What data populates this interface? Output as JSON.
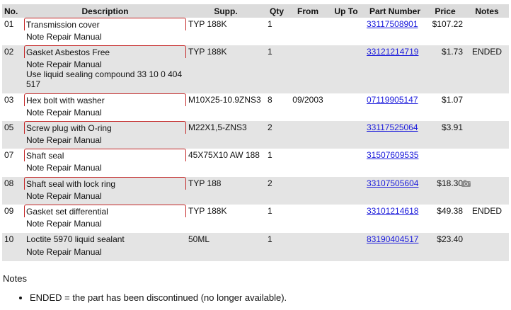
{
  "table": {
    "headers": {
      "no": "No.",
      "description": "Description",
      "supp": "Supp.",
      "qty": "Qty",
      "from": "From",
      "upto": "Up To",
      "part_number": "Part Number",
      "price": "Price",
      "notes": "Notes"
    },
    "rows": [
      {
        "no": "01",
        "desc": "Transmission cover",
        "note": "Note Repair Manual",
        "note2": "",
        "supp": "TYP 188K",
        "qty": "1",
        "from": "",
        "upto": "",
        "part_number": "33117508901",
        "price": "$107.22",
        "notes": ""
      },
      {
        "no": "02",
        "desc": "Gasket Asbestos Free",
        "note": "Note Repair Manual",
        "note2": "Use liquid sealing compound 33 10 0 404 517",
        "supp": "TYP 188K",
        "qty": "1",
        "from": "",
        "upto": "",
        "part_number": "33121214719",
        "price": "$1.73",
        "notes": "ENDED"
      },
      {
        "no": "03",
        "desc": "Hex bolt with washer",
        "note": "Note Repair Manual",
        "note2": "",
        "supp": "M10X25-10.9ZNS3",
        "qty": "8",
        "from": "09/2003",
        "upto": "",
        "part_number": "07119905147",
        "price": "$1.07",
        "notes": ""
      },
      {
        "no": "05",
        "desc": "Screw plug with O-ring",
        "note": "Note Repair Manual",
        "note2": "",
        "supp": "M22X1,5-ZNS3",
        "qty": "2",
        "from": "",
        "upto": "",
        "part_number": "33117525064",
        "price": "$3.91",
        "notes": ""
      },
      {
        "no": "07",
        "desc": "Shaft seal",
        "note": "Note Repair Manual",
        "note2": "",
        "supp": "45X75X10 AW 188",
        "qty": "1",
        "from": "",
        "upto": "",
        "part_number": "31507609535",
        "price": "",
        "notes": ""
      },
      {
        "no": "08",
        "desc": "Shaft seal with lock ring",
        "note": "Note Repair Manual",
        "note2": "",
        "supp": "TYP 188",
        "qty": "2",
        "from": "",
        "upto": "",
        "part_number": "33107505604",
        "price": "$18.30",
        "notes": "",
        "camera_icon": "camera-icon"
      },
      {
        "no": "09",
        "desc": "Gasket set differential",
        "note": "Note Repair Manual",
        "note2": "",
        "supp": "TYP 188K",
        "qty": "1",
        "from": "",
        "upto": "",
        "part_number": "33101214618",
        "price": "$49.38",
        "notes": "ENDED"
      },
      {
        "no": "10",
        "desc": "Loctite 5970 liquid sealant",
        "note": "Note Repair Manual",
        "note2": "",
        "supp": "50ML",
        "qty": "1",
        "from": "",
        "upto": "",
        "part_number": "83190404517",
        "price": "$23.40",
        "notes": "",
        "plain": true
      }
    ]
  },
  "notes_section": {
    "heading": "Notes",
    "items": [
      "ENDED = the part has been discontinued (no longer available)."
    ]
  },
  "colors": {
    "header_bg": "#dcdcdc",
    "row_alt_bg": "#e4e4e4",
    "link": "#1a1adb",
    "desc_border": "#c42727"
  }
}
